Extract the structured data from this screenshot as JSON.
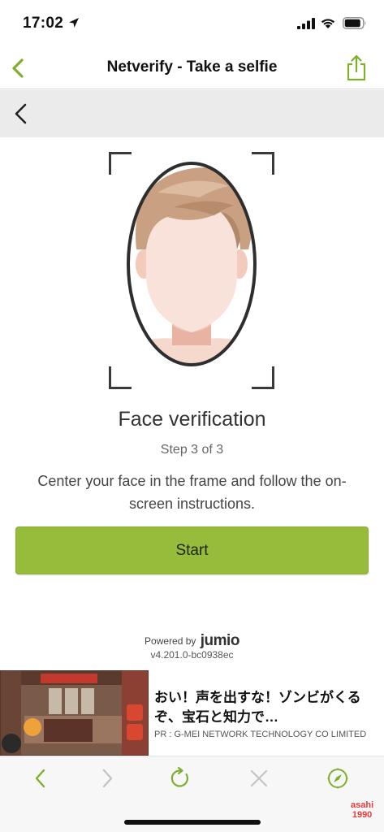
{
  "status_bar": {
    "time": "17:02"
  },
  "nav": {
    "title": "Netverify - Take a selfie"
  },
  "main": {
    "title": "Face verification",
    "step": "Step 3 of 3",
    "instructions": "Center your face in the frame and follow the on-screen instructions.",
    "start_label": "Start"
  },
  "footer": {
    "powered_by": "Powered by",
    "brand": "jumio",
    "version": "v4.201.0-bc0938ec"
  },
  "ad": {
    "headline": "おい！声を出すな！ゾンビがくるぞ、宝石と知力で…",
    "sponsor": "PR : G-MEI NETWORK TECHNOLOGY CO LIMITED"
  },
  "watermark": {
    "line1": "asahi",
    "line2": "1990"
  },
  "colors": {
    "accent": "#97bb3a",
    "icon_green": "#7fae2e",
    "subbar_bg": "#ebebeb"
  },
  "icons": [
    "location-arrow-icon",
    "signal-icon",
    "wifi-icon",
    "battery-icon",
    "back-chevron-icon",
    "share-icon",
    "reload-icon",
    "close-icon",
    "compass-icon"
  ]
}
